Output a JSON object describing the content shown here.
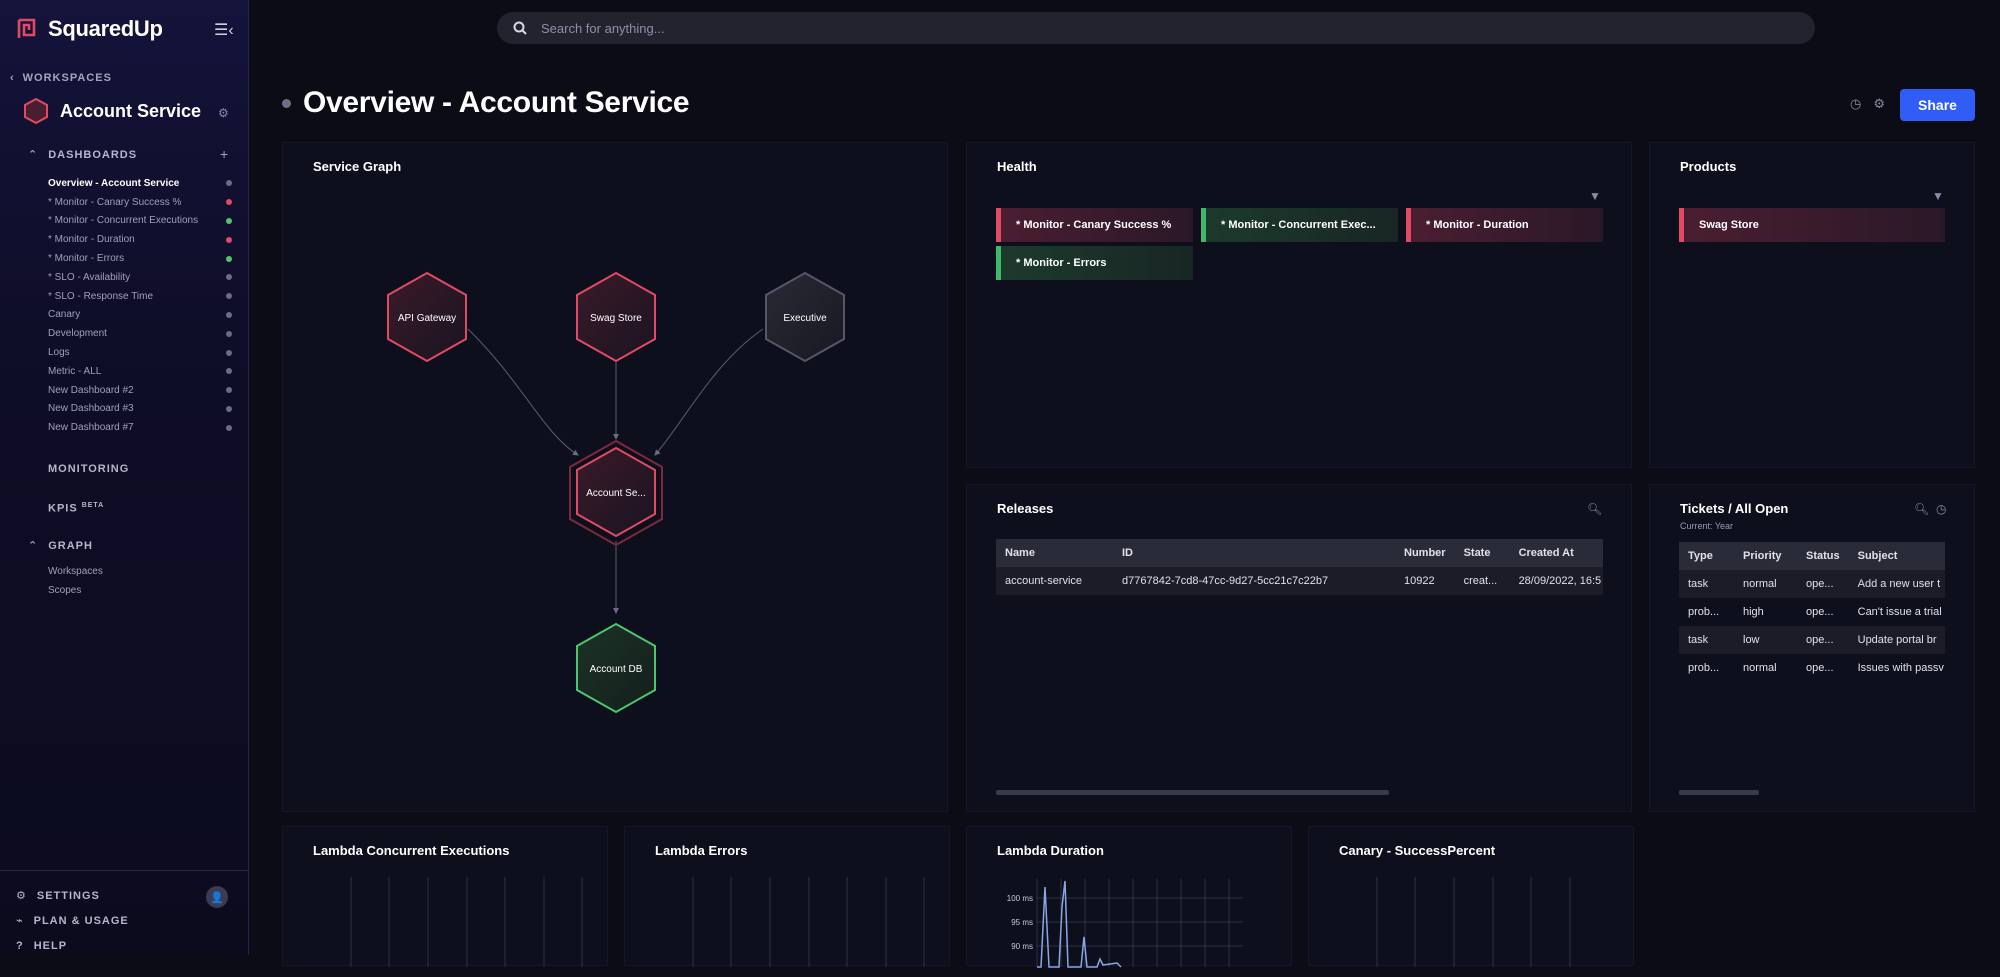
{
  "app": {
    "name": "SquaredUp"
  },
  "sidebar": {
    "workspaces_label": "WORKSPACES",
    "workspace_name": "Account Service",
    "dashboards_label": "DASHBOARDS",
    "dashboards": [
      {
        "label": "Overview - Account Service",
        "status": "grey",
        "active": true
      },
      {
        "label": "* Monitor - Canary Success %",
        "status": "red"
      },
      {
        "label": "* Monitor - Concurrent Executions",
        "status": "green"
      },
      {
        "label": "* Monitor - Duration",
        "status": "red"
      },
      {
        "label": "* Monitor - Errors",
        "status": "green"
      },
      {
        "label": "* SLO - Availability",
        "status": "grey"
      },
      {
        "label": "* SLO - Response Time",
        "status": "grey"
      },
      {
        "label": "Canary",
        "status": "grey"
      },
      {
        "label": "Development",
        "status": "grey"
      },
      {
        "label": "Logs",
        "status": "grey"
      },
      {
        "label": "Metric - ALL",
        "status": "grey"
      },
      {
        "label": "New Dashboard #2",
        "status": "grey"
      },
      {
        "label": "New Dashboard #3",
        "status": "grey"
      },
      {
        "label": "New Dashboard #7",
        "status": "grey"
      }
    ],
    "monitoring_label": "MONITORING",
    "kpis_label": "KPIS",
    "kpis_badge": "BETA",
    "graph_label": "GRAPH",
    "graph_items": [
      "Workspaces",
      "Scopes"
    ],
    "settings_label": "SETTINGS",
    "plan_label": "PLAN & USAGE",
    "help_label": "HELP"
  },
  "search": {
    "placeholder": "Search for anything..."
  },
  "header": {
    "title": "Overview - Account Service",
    "share_label": "Share"
  },
  "service_graph": {
    "title": "Service Graph",
    "nodes": [
      {
        "label": "API Gateway",
        "status": "red"
      },
      {
        "label": "Swag Store",
        "status": "red"
      },
      {
        "label": "Executive",
        "status": "grey"
      },
      {
        "label": "Account Se...",
        "status": "red"
      },
      {
        "label": "Account DB",
        "status": "green"
      }
    ]
  },
  "health": {
    "title": "Health",
    "tiles": [
      {
        "label": "* Monitor - Canary Success %",
        "status": "red"
      },
      {
        "label": "* Monitor - Concurrent Exec...",
        "status": "green"
      },
      {
        "label": "* Monitor - Duration",
        "status": "red"
      },
      {
        "label": "* Monitor - Errors",
        "status": "green"
      }
    ]
  },
  "products": {
    "title": "Products",
    "tiles": [
      {
        "label": "Swag Store",
        "status": "red"
      }
    ]
  },
  "releases": {
    "title": "Releases",
    "columns": [
      "Name",
      "ID",
      "Number",
      "State",
      "Created At"
    ],
    "rows": [
      [
        "account-service",
        "d7767842-7cd8-47cc-9d27-5cc21c7c22b7",
        "10922",
        "creat...",
        "28/09/2022, 16:5"
      ]
    ]
  },
  "tickets": {
    "title": "Tickets / All Open",
    "subtitle": "Current: Year",
    "columns": [
      "Type",
      "Priority",
      "Status",
      "Subject"
    ],
    "rows": [
      [
        "task",
        "normal",
        "ope...",
        "Add a new user t"
      ],
      [
        "prob...",
        "high",
        "ope...",
        "Can't issue a trial"
      ],
      [
        "task",
        "low",
        "ope...",
        "Update portal br"
      ],
      [
        "prob...",
        "normal",
        "ope...",
        "Issues with passv"
      ]
    ]
  },
  "bottom_charts": {
    "lambda_concurrent": {
      "title": "Lambda Concurrent Executions"
    },
    "lambda_errors": {
      "title": "Lambda Errors"
    },
    "lambda_duration": {
      "title": "Lambda Duration",
      "y_ticks": [
        "100 ms",
        "95 ms",
        "90 ms"
      ]
    },
    "canary": {
      "title": "Canary - SuccessPercent"
    }
  },
  "colors": {
    "accent": "#2f5df5",
    "red": "#e24a64",
    "green": "#4cc66c",
    "grey": "#6b6c84"
  }
}
